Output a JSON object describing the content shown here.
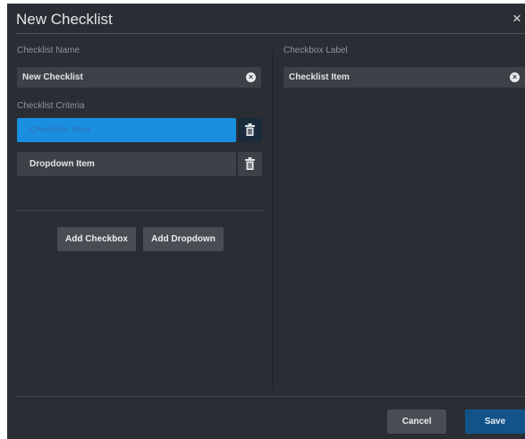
{
  "dialog": {
    "title": "New Checklist",
    "close_glyph": "×"
  },
  "left": {
    "name_label": "Checklist Name",
    "name_value": "New Checklist",
    "criteria_label": "Checklist Criteria",
    "criteria": [
      {
        "label": "Checklist Item",
        "selected": true
      },
      {
        "label": "Dropdown Item",
        "selected": false
      }
    ],
    "add_checkbox_label": "Add Checkbox",
    "add_dropdown_label": "Add Dropdown"
  },
  "right": {
    "checkbox_label": "Checkbox Label",
    "checkbox_value": "Checklist Item"
  },
  "footer": {
    "cancel_label": "Cancel",
    "save_label": "Save"
  },
  "icons": {
    "clear": "clear-circle-icon",
    "delete": "trash-icon",
    "close": "close-icon"
  },
  "colors": {
    "dialog_bg": "#2a2e34",
    "field_bg": "#3c4047",
    "selected_item": "#1a8fe0",
    "primary_button": "#12548a"
  }
}
